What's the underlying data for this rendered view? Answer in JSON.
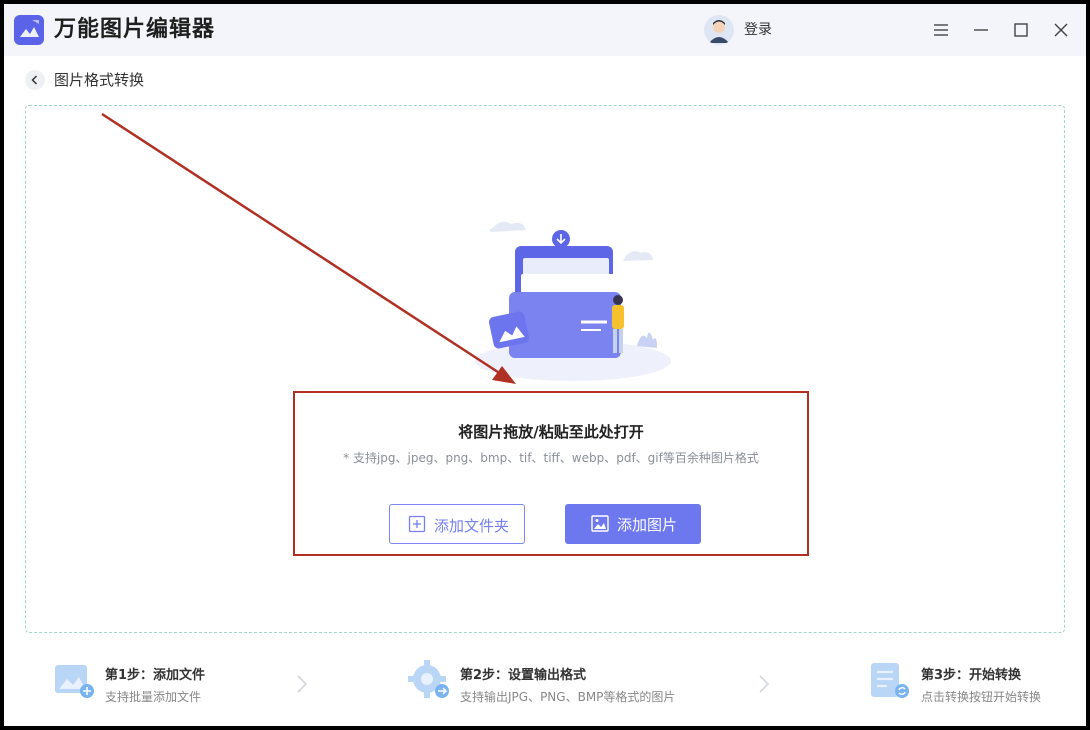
{
  "app": {
    "title": "万能图片编辑器"
  },
  "header": {
    "login_label": "登录"
  },
  "subheader": {
    "title": "图片格式转换"
  },
  "dropzone": {
    "title": "将图片拖放/粘贴至此处打开",
    "supported_formats": "* 支持jpg、jpeg、png、bmp、tif、tiff、webp、pdf、gif等百余种图片格式",
    "add_folder_label": "添加文件夹",
    "add_image_label": "添加图片"
  },
  "steps": [
    {
      "title": "第1步：添加文件",
      "desc": "支持批量添加文件"
    },
    {
      "title": "第2步：设置输出格式",
      "desc": "支持输出JPG、PNG、BMP等格式的图片"
    },
    {
      "title": "第3步：开始转换",
      "desc": "点击转换按钮开始转换"
    }
  ],
  "colors": {
    "accent": "#6d77ee",
    "annotation": "#b03024",
    "dropzone_border": "#9fd6cb"
  },
  "icons": {
    "logo": "app-logo-icon",
    "menu": "hamburger-menu-icon",
    "min": "minimize-icon",
    "max": "maximize-icon",
    "close": "close-icon",
    "back": "chevron-left-icon",
    "folder": "add-folder-icon",
    "image": "image-icon"
  }
}
